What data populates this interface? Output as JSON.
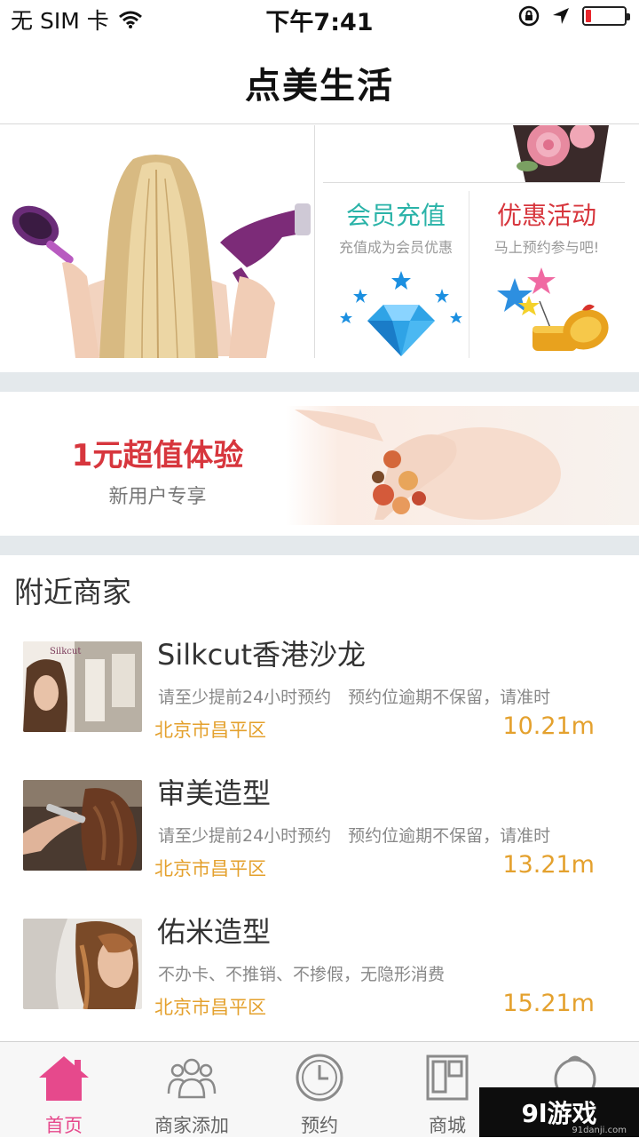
{
  "status_bar": {
    "carrier": "无 SIM 卡",
    "time": "下午7:41",
    "battery_level": 0.15
  },
  "nav": {
    "title": "点美生活"
  },
  "hero": {
    "member_card": {
      "title": "会员充值",
      "subtitle": "充值成为会员优惠",
      "color": "#2ab3a8"
    },
    "promo_card": {
      "title": "优惠活动",
      "subtitle": "马上预约参与吧!",
      "color": "#d7363d"
    }
  },
  "experience": {
    "title": "1元超值体验",
    "subtitle": "新用户专享"
  },
  "nearby": {
    "title": "附近商家",
    "shops": [
      {
        "name": "Silkcut香港沙龙",
        "desc": "请至少提前24小时预约　预约位逾期不保留，请准时",
        "location": "北京市昌平区",
        "distance": "10.21m"
      },
      {
        "name": "审美造型",
        "desc": "请至少提前24小时预约　预约位逾期不保留，请准时",
        "location": "北京市昌平区",
        "distance": "13.21m"
      },
      {
        "name": "佑米造型",
        "desc": "不办卡、不推销、不掺假，无隐形消费",
        "location": "北京市昌平区",
        "distance": "15.21m"
      }
    ]
  },
  "tabs": [
    {
      "label": "首页",
      "icon": "home-icon",
      "active": true
    },
    {
      "label": "商家添加",
      "icon": "people-icon"
    },
    {
      "label": "预约",
      "icon": "clock-icon"
    },
    {
      "label": "商城",
      "icon": "store-icon"
    },
    {
      "label": "",
      "icon": "profile-icon"
    }
  ],
  "watermark": {
    "text": "9l游戏",
    "domain": "91danji.com"
  },
  "colors": {
    "accent": "#e6498c",
    "orange": "#e4a12e",
    "red": "#d7363d",
    "teal": "#2ab3a8"
  }
}
